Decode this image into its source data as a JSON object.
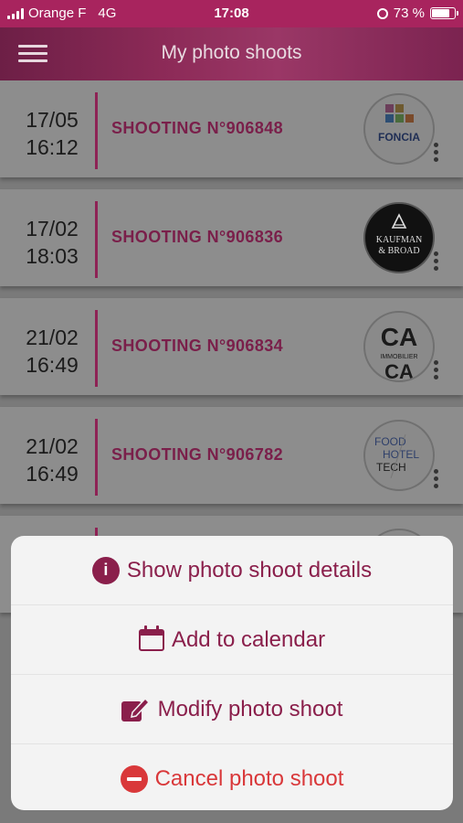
{
  "status_bar": {
    "carrier": "Orange F",
    "network": "4G",
    "time": "17:08",
    "battery": "73 %",
    "battery_level": 0.73
  },
  "header": {
    "title": "My photo shoots"
  },
  "shoots": [
    {
      "day": "17/05",
      "time": "16:12",
      "name": "SHOOTING N°906848",
      "logo": "foncia-logo",
      "logo_text": "FONCIA"
    },
    {
      "day": "17/02",
      "time": "18:03",
      "name": "SHOOTING N°906836",
      "logo": "kaufman-broad-logo",
      "logo_text": "KAUFMAN & BROAD"
    },
    {
      "day": "21/02",
      "time": "16:49",
      "name": "SHOOTING N°906834",
      "logo": "credit-agricole-immobilier-logo",
      "logo_text": "IMMOBILIER"
    },
    {
      "day": "21/02",
      "time": "16:49",
      "name": "SHOOTING N°906782",
      "logo": "food-hotel-tech-logo",
      "logo_text": "FOOD HOTEL TECH"
    }
  ],
  "action_sheet": {
    "details_label": "Show photo shoot details",
    "calendar_label": "Add to calendar",
    "modify_label": "Modify photo shoot",
    "cancel_label": "Cancel photo shoot"
  },
  "colors": {
    "accent": "#8a1f4b",
    "danger": "#d9383a",
    "status_bar": "#a8245e"
  }
}
